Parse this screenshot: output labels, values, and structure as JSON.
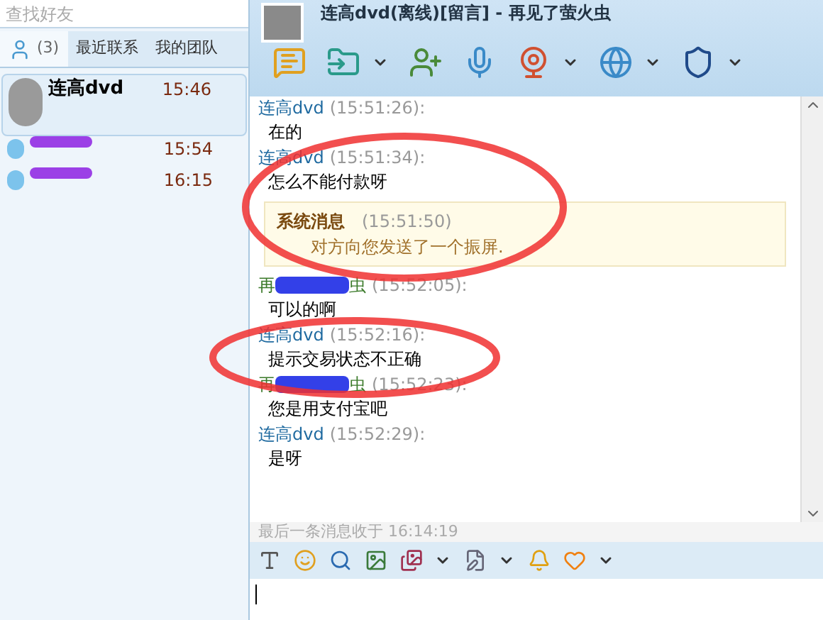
{
  "search": {
    "placeholder": "查找好友"
  },
  "tabs": [
    {
      "label": "(3)",
      "kind": "contacts",
      "selected": true
    },
    {
      "label": "最近联系",
      "kind": "text",
      "selected": false
    },
    {
      "label": "我的团队",
      "kind": "text",
      "selected": false
    }
  ],
  "contacts": [
    {
      "name": "连高dvd",
      "time": "15:46",
      "selected": true,
      "redacted": false
    },
    {
      "time": "15:54",
      "selected": false,
      "redacted": true
    },
    {
      "time": "16:15",
      "selected": false,
      "redacted": true
    }
  ],
  "chat": {
    "title": "连高dvd(离线)[留言] - 再见了萤火虫",
    "messages": [
      {
        "kind": "peer",
        "sender": "连高dvd",
        "time": "(15:51:26):",
        "text": "在的"
      },
      {
        "kind": "peer",
        "sender": "连高dvd",
        "time": "(15:51:34):",
        "text": "怎么不能付款呀"
      },
      {
        "kind": "system",
        "sender": "系统消息",
        "time": "(15:51:50)",
        "text": "对方向您发送了一个振屏."
      },
      {
        "kind": "self",
        "sender_start": "再",
        "sender_end": "虫",
        "time": "(15:52:05):",
        "text": "可以的啊"
      },
      {
        "kind": "peer",
        "sender": "连高dvd",
        "time": "(15:52:16):",
        "text": "提示交易状态不正确"
      },
      {
        "kind": "self",
        "sender_start": "再",
        "sender_end": "虫",
        "time": "(15:52:23):",
        "text": "您是用支付宝吧"
      },
      {
        "kind": "peer",
        "sender": "连高dvd",
        "time": "(15:52:29):",
        "text": "是呀"
      }
    ],
    "last_message": "最后一条消息收于 16:14:19"
  }
}
